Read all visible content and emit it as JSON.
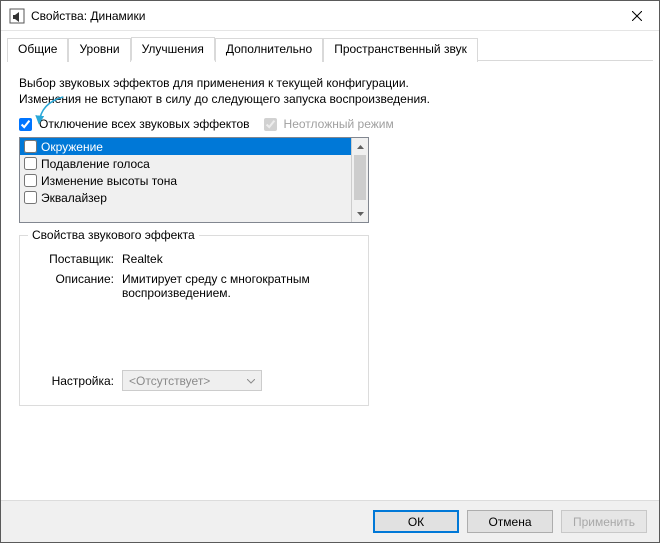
{
  "window": {
    "title": "Свойства: Динамики"
  },
  "tabs": [
    {
      "label": "Общие"
    },
    {
      "label": "Уровни"
    },
    {
      "label": "Улучшения"
    },
    {
      "label": "Дополнительно"
    },
    {
      "label": "Пространственный звук"
    }
  ],
  "active_tab_index": 2,
  "enhancements": {
    "description": "Выбор звуковых эффектов для применения к текущей конфигурации. Изменения не вступают в силу до следующего запуска воспроизведения.",
    "disable_all_label": "Отключение всех звуковых эффектов",
    "disable_all_checked": true,
    "immediate_mode_label": "Неотложный режим",
    "immediate_mode_checked": true,
    "effects": [
      {
        "label": "Окружение",
        "checked": false,
        "selected": true
      },
      {
        "label": "Подавление голоса",
        "checked": false,
        "selected": false
      },
      {
        "label": "Изменение высоты тона",
        "checked": false,
        "selected": false
      },
      {
        "label": "Эквалайзер",
        "checked": false,
        "selected": false
      }
    ],
    "props": {
      "legend": "Свойства звукового эффекта",
      "provider_label": "Поставщик:",
      "provider_value": "Realtek",
      "description_label": "Описание:",
      "description_value": "Имитирует среду с многократным воспроизведением.",
      "setting_label": "Настройка:",
      "setting_value": "<Отсутствует>"
    }
  },
  "buttons": {
    "ok": "ОК",
    "cancel": "Отмена",
    "apply": "Применить"
  }
}
